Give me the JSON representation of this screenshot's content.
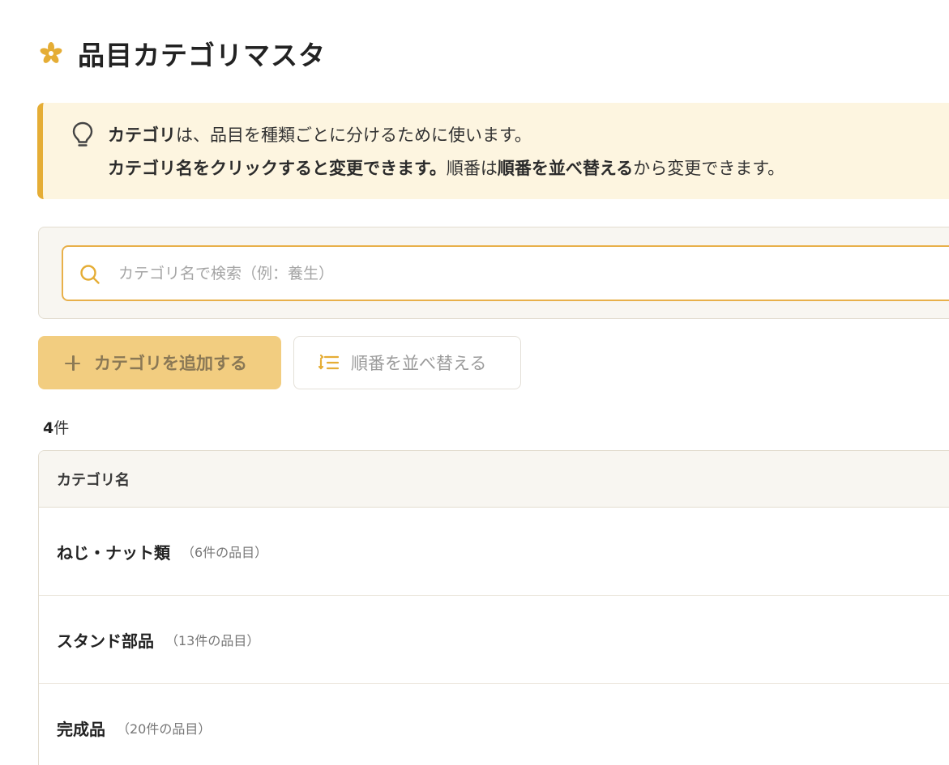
{
  "header": {
    "title": "品目カテゴリマスタ",
    "icon": "flower-icon",
    "accent_color": "#e5ad35"
  },
  "info": {
    "icon": "lightbulb-icon",
    "line1_bold": "カテゴリ",
    "line1_rest": "は、品目を種類ごとに分けるために使います。",
    "line2_bold1": "カテゴリ名をクリックすると変更できます。",
    "line2_mid": "順番は",
    "line2_bold2": "順番を並べ替える",
    "line2_end": "から変更できます。",
    "background": "#fdf5e0"
  },
  "search": {
    "placeholder": "カテゴリ名で検索（例：養生）",
    "value": "",
    "icon": "search-icon"
  },
  "toolbar": {
    "add_label": "カテゴリを追加する",
    "add_icon": "plus-icon",
    "sort_label": "順番を並べ替える",
    "sort_icon": "sort-icon"
  },
  "count": {
    "number": "4",
    "unit": "件"
  },
  "table": {
    "header": "カテゴリ名",
    "rows": [
      {
        "name": "ねじ・ナット類",
        "count": "（6件の品目）"
      },
      {
        "name": "スタンド部品",
        "count": "（13件の品目）"
      },
      {
        "name": "完成品",
        "count": "（20件の品目）"
      }
    ]
  }
}
